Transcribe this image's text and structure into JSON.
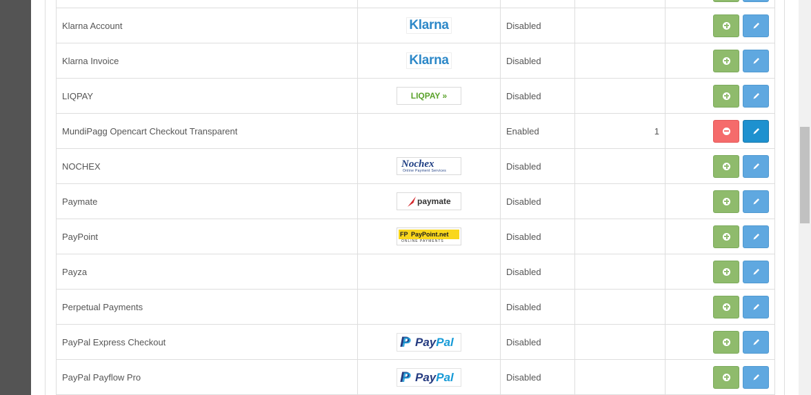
{
  "colors": {
    "install": "#8fbb6c",
    "uninstall": "#f56b6b",
    "edit": "#5fa8e0",
    "edit_active": "#1e91cf"
  },
  "rows": [
    {
      "name": "",
      "logo": "none",
      "status": "",
      "order": "",
      "installed": false
    },
    {
      "name": "Klarna Account",
      "logo": "klarna",
      "logo_text": "Klarna",
      "status": "Disabled",
      "order": "",
      "installed": false
    },
    {
      "name": "Klarna Invoice",
      "logo": "klarna",
      "logo_text": "Klarna",
      "status": "Disabled",
      "order": "",
      "installed": false
    },
    {
      "name": "LIQPAY",
      "logo": "liqpay",
      "logo_text": "LIQPAY »",
      "status": "Disabled",
      "order": "",
      "installed": false
    },
    {
      "name": "MundiPagg Opencart Checkout Transparent",
      "logo": "none",
      "status": "Enabled",
      "order": "1",
      "installed": true
    },
    {
      "name": "NOCHEX",
      "logo": "nochex",
      "logo_text": "Nochex",
      "logo_sub": "Online Payment Services",
      "status": "Disabled",
      "order": "",
      "installed": false
    },
    {
      "name": "Paymate",
      "logo": "paymate",
      "logo_text": "paymate",
      "status": "Disabled",
      "order": "",
      "installed": false
    },
    {
      "name": "PayPoint",
      "logo": "paypoint",
      "logo_text": "PayPoint.net",
      "logo_badge": "FP",
      "logo_sub": "ONLINE PAYMENTS",
      "status": "Disabled",
      "order": "",
      "installed": false
    },
    {
      "name": "Payza",
      "logo": "none",
      "status": "Disabled",
      "order": "",
      "installed": false
    },
    {
      "name": "Perpetual Payments",
      "logo": "none",
      "status": "Disabled",
      "order": "",
      "installed": false
    },
    {
      "name": "PayPal Express Checkout",
      "logo": "paypal",
      "logo_text_a": "Pay",
      "logo_text_b": "Pal",
      "logo_mark": "P",
      "status": "Disabled",
      "order": "",
      "installed": false
    },
    {
      "name": "PayPal Payflow Pro",
      "logo": "paypal",
      "logo_text_a": "Pay",
      "logo_text_b": "Pal",
      "logo_mark": "P",
      "status": "Disabled",
      "order": "",
      "installed": false
    }
  ]
}
